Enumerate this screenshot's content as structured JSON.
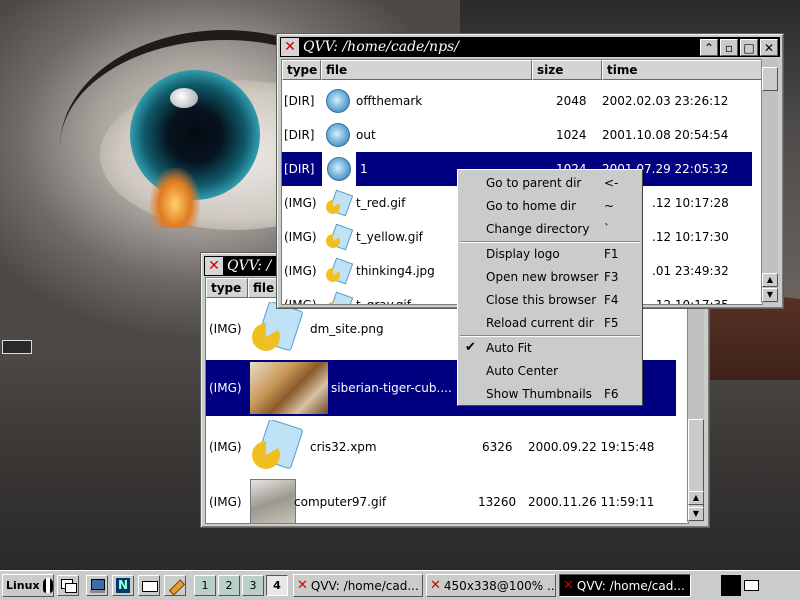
{
  "back_window": {
    "title": "QVV: /",
    "columns": [
      "type",
      "file"
    ],
    "rows": [
      {
        "type": "(IMG)",
        "file": "dm_site.png",
        "size": "",
        "time": "",
        "thumb": "image-file-icon"
      },
      {
        "type": "(IMG)",
        "file": "siberian-tiger-cub....",
        "size": "",
        "time": "",
        "thumb": "tiger-thumbnail",
        "selected": true
      },
      {
        "type": "(IMG)",
        "file": "cris32.xpm",
        "size": "6326",
        "time": "2000.09.22 19:15:48",
        "thumb": "image-file-icon"
      },
      {
        "type": "(IMG)",
        "file": "computer97.gif",
        "size": "13260",
        "time": "2000.11.26 11:59:11",
        "thumb": "computer-thumbnail"
      }
    ]
  },
  "front_window": {
    "title": "QVV: /home/cade/nps/",
    "columns": [
      "type",
      "file",
      "size",
      "time"
    ],
    "rows": [
      {
        "type": "[DIR]",
        "file": "offthemark",
        "size": "2048",
        "time": "2002.02.03 23:26:12",
        "icon": "folder-gear-icon"
      },
      {
        "type": "[DIR]",
        "file": "out",
        "size": "1024",
        "time": "2001.10.08 20:54:54",
        "icon": "folder-gear-icon"
      },
      {
        "type": "[DIR]",
        "file": "1",
        "size": "1024",
        "time": "2001.07.29 22:05:32",
        "icon": "folder-gear-icon",
        "selected": true
      },
      {
        "type": "(IMG)",
        "file": "t_red.gif",
        "size": "",
        "time": ".12 10:17:28",
        "icon": "image-file-icon"
      },
      {
        "type": "(IMG)",
        "file": "t_yellow.gif",
        "size": "",
        "time": ".12 10:17:30",
        "icon": "image-file-icon"
      },
      {
        "type": "(IMG)",
        "file": "thinking4.jpg",
        "size": "",
        "time": ".01 23:49:32",
        "icon": "image-file-icon"
      },
      {
        "type": "(IMG)",
        "file": "t_gray.gif",
        "size": "",
        "time": ".12 10:17:35",
        "icon": "image-file-icon"
      }
    ]
  },
  "context_menu": {
    "items": [
      {
        "label": "Go to parent dir",
        "key": "<-"
      },
      {
        "label": "Go to home dir",
        "key": "~"
      },
      {
        "label": "Change directory",
        "key": "`"
      },
      {
        "separator": true
      },
      {
        "label": "Display logo",
        "key": "F1"
      },
      {
        "label": "Open new browser",
        "key": "F3"
      },
      {
        "label": "Close this browser",
        "key": "F4"
      },
      {
        "label": "Reload current dir",
        "key": "F5"
      },
      {
        "separator": true
      },
      {
        "label": "Auto Fit",
        "key": "",
        "checked": true
      },
      {
        "label": "Auto Center",
        "key": ""
      },
      {
        "label": "Show Thumbnails",
        "key": "F6"
      }
    ]
  },
  "taskbar": {
    "start_label": "Linux",
    "desktops": [
      "1",
      "2",
      "3",
      "4"
    ],
    "current_desktop": "4",
    "tasks": [
      {
        "label": "QVV: /home/cad..."
      },
      {
        "label": "450x338@100% ..."
      },
      {
        "label": "QVV: /home/cad..."
      }
    ],
    "tray_icons": [
      "monitor-icon",
      "mail-icon"
    ]
  },
  "colors": {
    "selection": "#000080",
    "titlebar": "#000000",
    "window_bg": "#c9ccc9",
    "close_x": "#d00000"
  }
}
